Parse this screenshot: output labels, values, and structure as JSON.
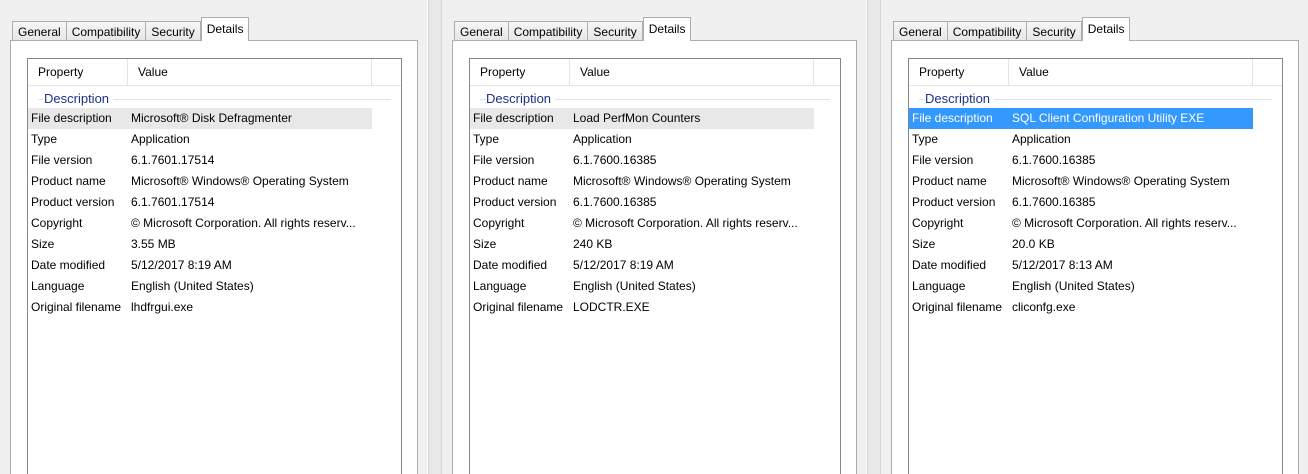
{
  "tabs": [
    "General",
    "Compatibility",
    "Security",
    "Details"
  ],
  "columns": {
    "property": "Property",
    "value": "Value"
  },
  "group_label": "Description",
  "panels": [
    {
      "rows": [
        {
          "k": "File description",
          "v": "Microsoft® Disk Defragmenter"
        },
        {
          "k": "Type",
          "v": "Application"
        },
        {
          "k": "File version",
          "v": "6.1.7601.17514"
        },
        {
          "k": "Product name",
          "v": "Microsoft® Windows® Operating System"
        },
        {
          "k": "Product version",
          "v": "6.1.7601.17514"
        },
        {
          "k": "Copyright",
          "v": "© Microsoft Corporation. All rights reserv..."
        },
        {
          "k": "Size",
          "v": "3.55 MB"
        },
        {
          "k": "Date modified",
          "v": "5/12/2017 8:19 AM"
        },
        {
          "k": "Language",
          "v": "English (United States)"
        },
        {
          "k": "Original filename",
          "v": "lhdfrgui.exe"
        }
      ]
    },
    {
      "rows": [
        {
          "k": "File description",
          "v": "Load PerfMon Counters"
        },
        {
          "k": "Type",
          "v": "Application"
        },
        {
          "k": "File version",
          "v": "6.1.7600.16385"
        },
        {
          "k": "Product name",
          "v": "Microsoft® Windows® Operating System"
        },
        {
          "k": "Product version",
          "v": "6.1.7600.16385"
        },
        {
          "k": "Copyright",
          "v": "© Microsoft Corporation. All rights reserv..."
        },
        {
          "k": "Size",
          "v": "240 KB"
        },
        {
          "k": "Date modified",
          "v": "5/12/2017 8:19 AM"
        },
        {
          "k": "Language",
          "v": "English (United States)"
        },
        {
          "k": "Original filename",
          "v": "LODCTR.EXE"
        }
      ]
    },
    {
      "rows": [
        {
          "k": "File description",
          "v": "SQL Client Configuration Utility EXE"
        },
        {
          "k": "Type",
          "v": "Application"
        },
        {
          "k": "File version",
          "v": "6.1.7600.16385"
        },
        {
          "k": "Product name",
          "v": "Microsoft® Windows® Operating System"
        },
        {
          "k": "Product version",
          "v": "6.1.7600.16385"
        },
        {
          "k": "Copyright",
          "v": "© Microsoft Corporation. All rights reserv..."
        },
        {
          "k": "Size",
          "v": "20.0 KB"
        },
        {
          "k": "Date modified",
          "v": "5/12/2017 8:13 AM"
        },
        {
          "k": "Language",
          "v": "English (United States)"
        },
        {
          "k": "Original filename",
          "v": "cliconfg.exe"
        }
      ]
    }
  ],
  "colors": {
    "group_title": "#1e3287",
    "selection_blue": "#3399ff",
    "selection_gray": "#e8e8e8"
  }
}
